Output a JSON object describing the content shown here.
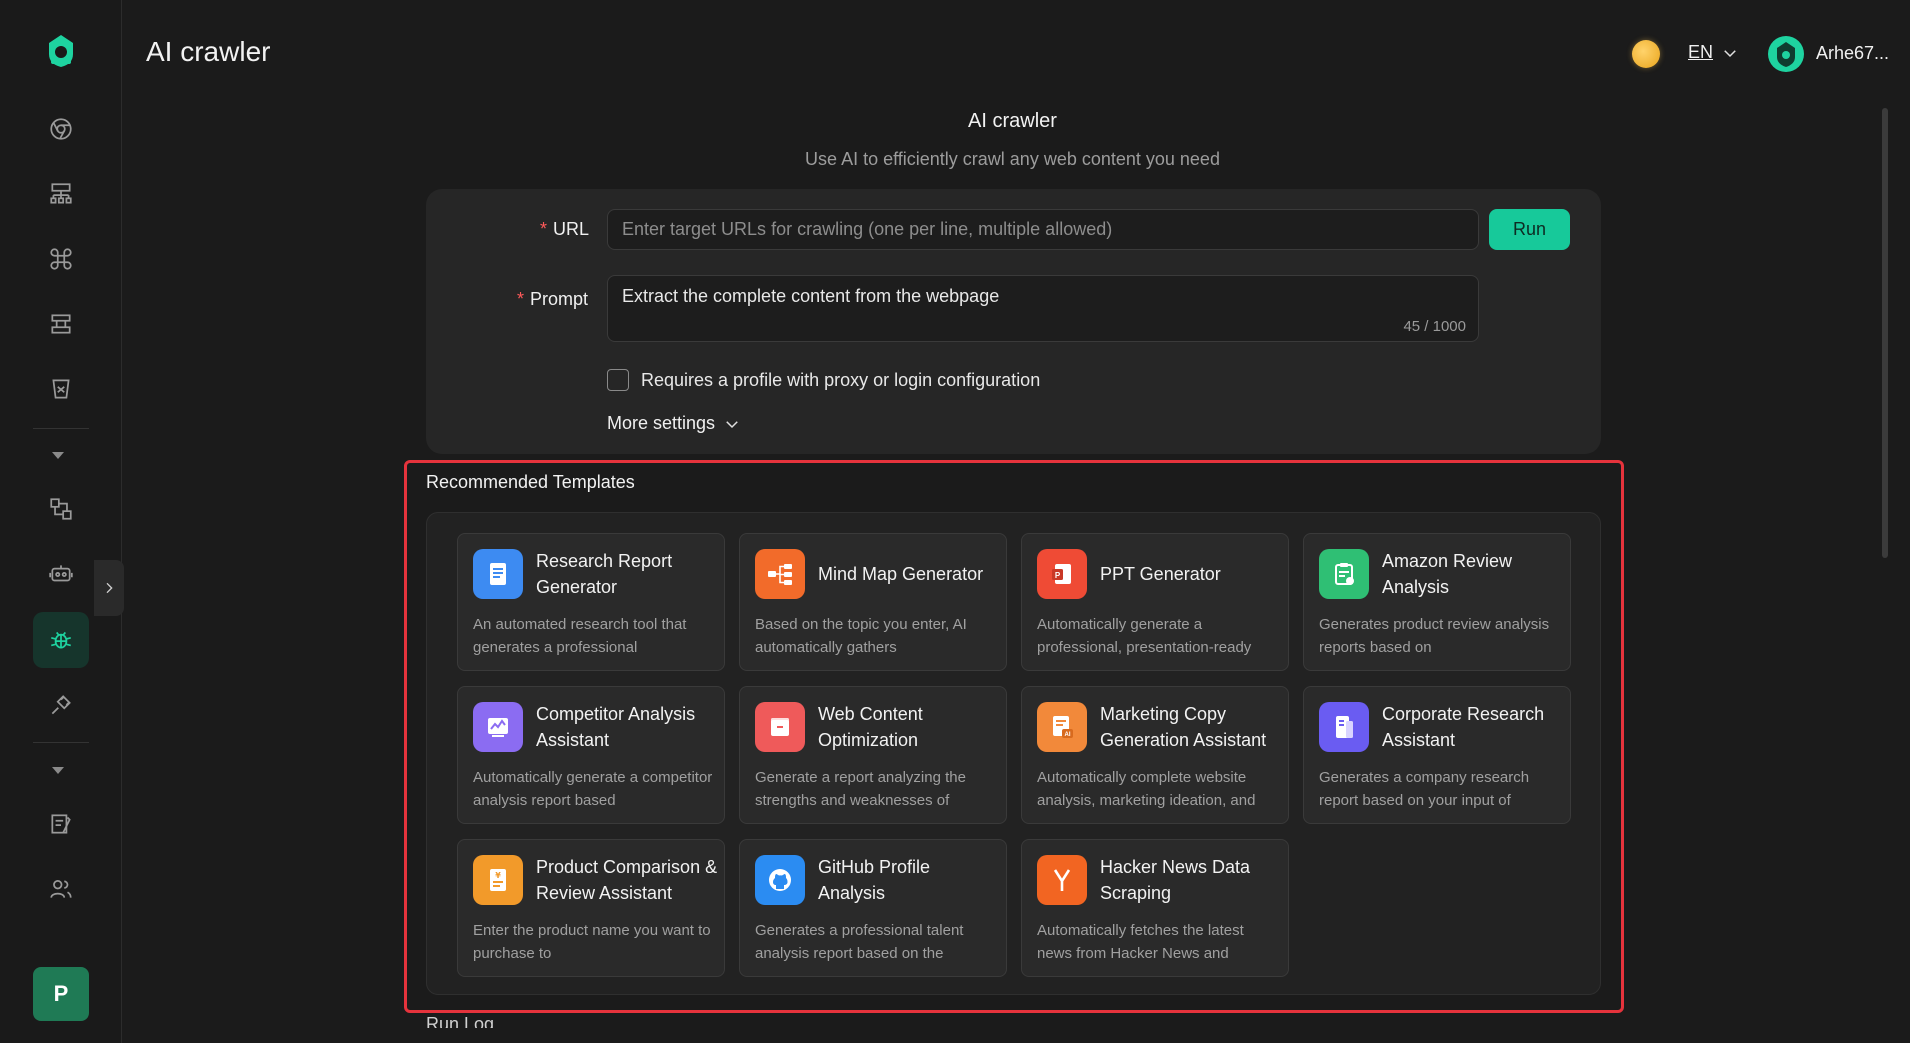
{
  "header": {
    "title": "AI crawler",
    "lang": "EN",
    "user_name": "Arhe67..."
  },
  "sidebar": {
    "icons": [
      "browser-icon",
      "sitemap-icon",
      "command-icon",
      "layers-icon",
      "bucket-icon",
      "transfer-icon",
      "robot-icon",
      "bug-icon",
      "plug-icon",
      "notes-icon",
      "users-icon"
    ],
    "active": "bug-icon",
    "workspace_initial": "P"
  },
  "main": {
    "title": "AI crawler",
    "subtitle": "Use AI to efficiently crawl any web content you need"
  },
  "form": {
    "url_label": "URL",
    "url_placeholder": "Enter target URLs for crawling (one per line, multiple allowed)",
    "run_label": "Run",
    "prompt_label": "Prompt",
    "prompt_value": "Extract the complete content from the webpage",
    "prompt_count": "45 / 1000",
    "checkbox_label": "Requires a profile with proxy or login configuration",
    "more_settings": "More settings"
  },
  "templates": {
    "title": "Recommended Templates",
    "items": [
      {
        "name": "Research Report Generator",
        "desc": "An automated research tool that generates a professional",
        "color": "#3d8bf2",
        "icon": "document-icon"
      },
      {
        "name": "Mind Map Generator",
        "desc": "Based on the topic you enter, AI automatically gathers",
        "color": "#f26b2a",
        "icon": "mindmap-icon"
      },
      {
        "name": "PPT Generator",
        "desc": "Automatically generate a professional, presentation-ready",
        "color": "#ef4b35",
        "icon": "ppt-icon"
      },
      {
        "name": "Amazon Review Analysis",
        "desc": "Generates product review analysis reports based on",
        "color": "#2fbf74",
        "icon": "clipboard-icon"
      },
      {
        "name": "Competitor Analysis Assistant",
        "desc": "Automatically generate a competitor analysis report based",
        "color": "#8b6cf2",
        "icon": "chart-icon"
      },
      {
        "name": "Web Content Optimization",
        "desc": "Generate a report analyzing the strengths and weaknesses of",
        "color": "#ef5a5a",
        "icon": "archive-icon"
      },
      {
        "name": "Marketing Copy Generation Assistant",
        "desc": "Automatically complete website analysis, marketing ideation, and",
        "color": "#f2893a",
        "icon": "ai-doc-icon"
      },
      {
        "name": "Corporate Research Assistant",
        "desc": "Generates a company research report based on your input of",
        "color": "#6a5cf2",
        "icon": "file-icon"
      },
      {
        "name": "Product Comparison & Review Assistant",
        "desc": "Enter the product name you want to purchase to",
        "color": "#f29a2a",
        "icon": "receipt-icon"
      },
      {
        "name": "GitHub Profile Analysis",
        "desc": "Generates a professional talent analysis report based on the",
        "color": "#2b8cf2",
        "icon": "github-icon"
      },
      {
        "name": "Hacker News Data Scraping",
        "desc": "Automatically fetches the latest news from Hacker News and",
        "color": "#f26522",
        "icon": "ycombinator-icon"
      }
    ]
  },
  "runlog_label": "Run Log"
}
